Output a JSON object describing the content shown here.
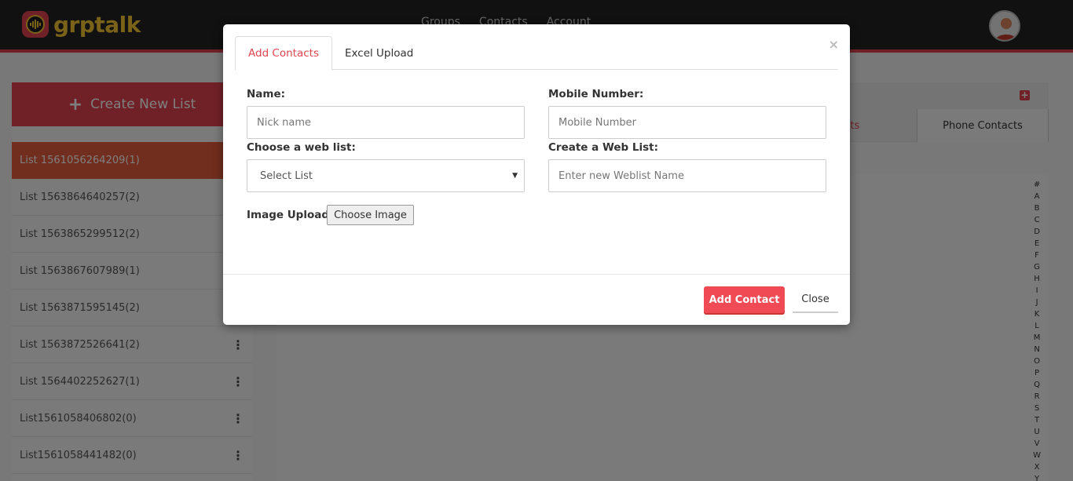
{
  "app": {
    "logo_text": "grptalk"
  },
  "topnav": {
    "items": [
      "Groups",
      "Contacts",
      "Account"
    ]
  },
  "left_panel": {
    "create_label": "Create New List",
    "lists": [
      {
        "label": "List 1561056264209(1)",
        "active": true
      },
      {
        "label": "List 1563864640257(2)"
      },
      {
        "label": "List 1563865299512(2)"
      },
      {
        "label": "List 1563867607989(1)"
      },
      {
        "label": "List 1563871595145(2)"
      },
      {
        "label": "List 1563872526641(2)"
      },
      {
        "label": "List 1564402252627(1)"
      },
      {
        "label": "List1561058406802(0)"
      },
      {
        "label": "List1561058441482(0)"
      }
    ]
  },
  "right_panel": {
    "tabs": {
      "web_lists": "eb Lists",
      "phone_contacts": "Phone Contacts"
    },
    "alphabet": [
      "#",
      "A",
      "B",
      "C",
      "D",
      "E",
      "F",
      "G",
      "H",
      "I",
      "J",
      "K",
      "L",
      "M",
      "N",
      "O",
      "P",
      "Q",
      "R",
      "S",
      "T",
      "U",
      "V",
      "W",
      "X",
      "Y"
    ]
  },
  "modal": {
    "close_glyph": "×",
    "tabs": {
      "add_contacts": "Add Contacts",
      "excel_upload": "Excel Upload"
    },
    "name_label": "Name:",
    "name_placeholder": "Nick name",
    "mobile_label": "Mobile Number:",
    "mobile_placeholder": "Mobile Number",
    "web_list_label": "Choose a web list:",
    "web_list_selected": "Select List",
    "create_web_list_label": "Create a Web List:",
    "create_web_list_placeholder": "Enter new Weblist Name",
    "image_upload_label": "Image Upload:",
    "choose_image_label": "Choose Image",
    "add_contact_label": "Add Contact",
    "close_label": "Close"
  },
  "colors": {
    "accent": "#e0434f",
    "active_list": "#e25a3b",
    "logo": "#f4c430"
  }
}
